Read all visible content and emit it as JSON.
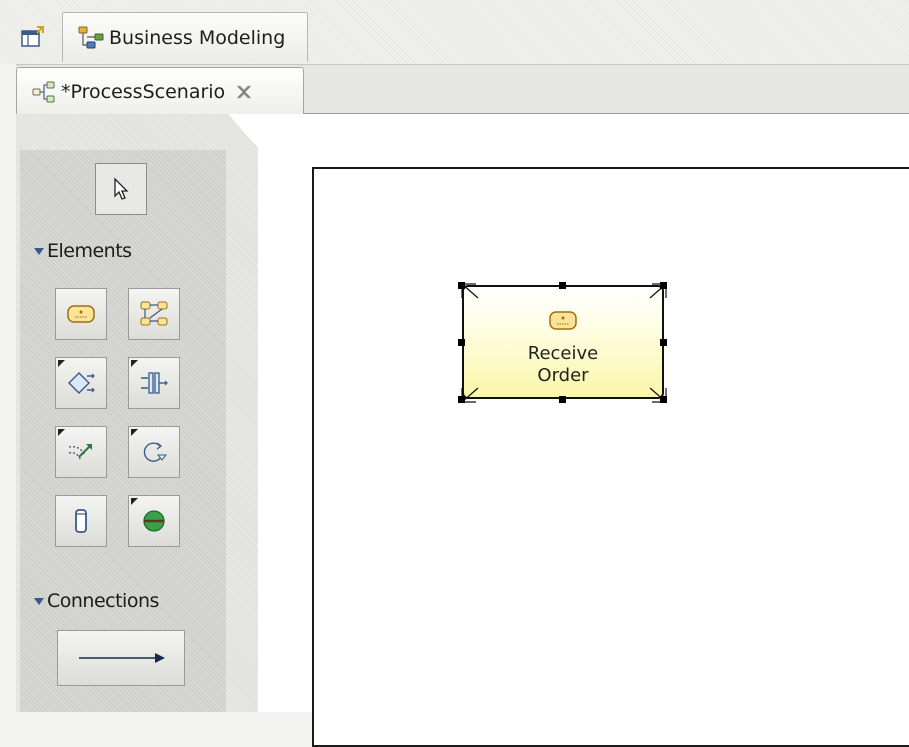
{
  "perspective": {
    "tab_label": "Business Modeling",
    "open_perspective_icon": "open-perspective-icon",
    "tab_icon": "business-modeling-icon"
  },
  "editor": {
    "tab_label": "*ProcessScenario",
    "tab_icon": "process-scenario-icon",
    "close_icon": "close-icon"
  },
  "palette": {
    "select_tool_icon": "arrow-pointer-icon",
    "elements_drawer": {
      "label": "Elements",
      "tools": [
        {
          "name": "task-tool",
          "icon": "task-icon"
        },
        {
          "name": "subprocess-tool",
          "icon": "subprocess-icon"
        },
        {
          "name": "decision-tool",
          "icon": "decision-icon"
        },
        {
          "name": "fork-tool",
          "icon": "fork-icon"
        },
        {
          "name": "event-tool",
          "icon": "event-icon"
        },
        {
          "name": "loop-tool",
          "icon": "loop-icon"
        },
        {
          "name": "datastore-tool",
          "icon": "datastore-icon"
        },
        {
          "name": "start-end-tool",
          "icon": "start-end-icon"
        }
      ]
    },
    "connections_drawer": {
      "label": "Connections",
      "tool_icon": "connection-arrow-icon"
    }
  },
  "diagram": {
    "task": {
      "label_line1": "Receive",
      "label_line2": "Order",
      "icon": "task-icon",
      "fill_color": "#fbf6a8"
    }
  }
}
